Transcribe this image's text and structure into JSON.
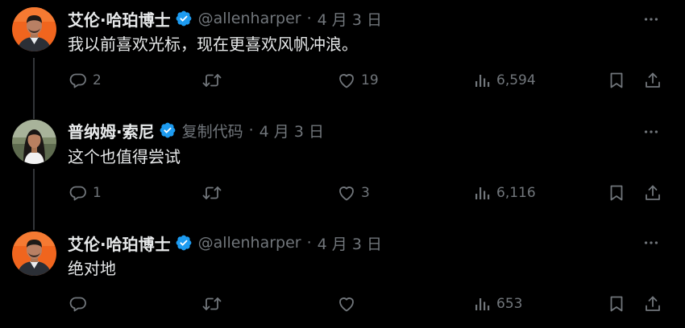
{
  "tweets": [
    {
      "author": "艾伦·哈珀博士",
      "handle": "@allenharper",
      "separator": "·",
      "date": "4 月 3 日",
      "text": "我以前喜欢光标，现在更喜欢风帆冲浪。",
      "avatar_icon": "avatar-man-orange-bg",
      "verified": true,
      "stats": {
        "replies": "2",
        "retweets": "",
        "likes": "19",
        "views": "6,594"
      }
    },
    {
      "author": "普纳姆·索尼",
      "handle": "复制代码",
      "separator": "·",
      "date": "4 月 3 日",
      "text": "这个也值得尝试",
      "avatar_icon": "avatar-woman-outdoor",
      "verified": true,
      "stats": {
        "replies": "1",
        "retweets": "",
        "likes": "3",
        "views": "6,116"
      }
    },
    {
      "author": "艾伦·哈珀博士",
      "handle": "@allenharper",
      "separator": "·",
      "date": "4 月 3 日",
      "text": "绝对地",
      "avatar_icon": "avatar-man-orange-bg",
      "verified": true,
      "stats": {
        "replies": "",
        "retweets": "",
        "likes": "",
        "views": "653"
      }
    }
  ],
  "colors": {
    "background": "#000000",
    "text": "#e7e9ea",
    "muted": "#71767b",
    "verified": "#1d9bf0",
    "thread_line": "#333639"
  },
  "icons": [
    "verified-badge-icon",
    "more-icon",
    "reply-icon",
    "retweet-icon",
    "like-icon",
    "views-icon",
    "bookmark-icon",
    "share-icon"
  ]
}
